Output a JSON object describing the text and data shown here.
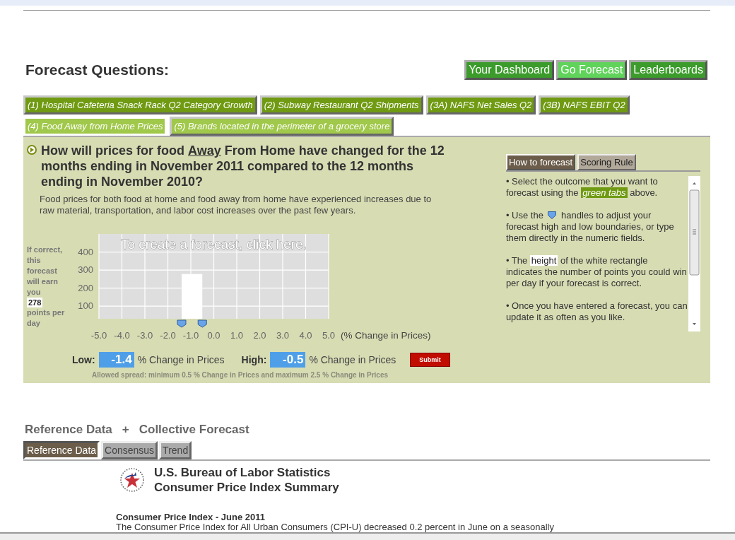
{
  "heading": "Forecast Questions:",
  "nav": [
    {
      "label": "Your Dashboard",
      "selected": false
    },
    {
      "label": "Go Forecast",
      "selected": true
    },
    {
      "label": "Leaderboards",
      "selected": false
    }
  ],
  "question_tabs": [
    {
      "label": "(1) Hospital Cafeteria Snack Rack Q2 Category Growth",
      "selected": false,
      "color": "#6f9a12"
    },
    {
      "label": "(2) Subway Restaurant Q2 Shipments",
      "selected": false,
      "color": "#6f9a12"
    },
    {
      "label": "(3A) NAFS Net Sales Q2",
      "selected": false,
      "color": "#6f9a12"
    },
    {
      "label": "(3B) NAFS EBIT Q2",
      "selected": false,
      "color": "#6f9a12"
    },
    {
      "label": "(4) Food Away from Home Prices",
      "selected": true,
      "color": "#a0c84a"
    },
    {
      "label": "(5) Brands located in the perimeter of a grocery store",
      "selected": false,
      "color": "#a0c84a"
    }
  ],
  "question": {
    "title": "How will prices for food **Away** From Home have changed for the 12 months ending in November 2011 compared to the 12 months ending in November 2010?",
    "description": "Food prices for both food at home and food away from home have experienced increases due to raw material, transportation, and labor cost increases over the past few years."
  },
  "earn": {
    "before": "If correct, this forecast will earn you",
    "points": "278",
    "after": "points per day"
  },
  "chart_data": {
    "type": "bar",
    "xlabel": "(% Change in Prices)",
    "xlim": [
      -5,
      5
    ],
    "ylim": [
      30,
      500
    ],
    "grid": true,
    "xticks": [
      {
        "value": -5,
        "label": "-5.0"
      },
      {
        "value": -4,
        "label": "-4.0"
      },
      {
        "value": -3,
        "label": "-3.0"
      },
      {
        "value": -2,
        "label": "-2.0"
      },
      {
        "value": -1,
        "label": "-1.0"
      },
      {
        "value": 0,
        "label": "0.0"
      },
      {
        "value": 1,
        "label": "1.0"
      },
      {
        "value": 2,
        "label": "2.0"
      },
      {
        "value": 3,
        "label": "3.0"
      },
      {
        "value": 4,
        "label": "4.0"
      },
      {
        "value": 5,
        "label": "5.0"
      }
    ],
    "yticks": [
      100,
      200,
      300,
      400
    ],
    "x": [
      -0.95
    ],
    "values": [
      278
    ],
    "annotations": [
      "To create a forecast, click here."
    ]
  },
  "range": {
    "low_label": "Low:",
    "low": "-1.4",
    "high_label": "High:",
    "high": "-0.5",
    "unit_low": "% Change in Prices",
    "unit_high": "% Change in Prices",
    "submit": "Submit",
    "note": "Allowed spread: minimum 0.5 % Change in Prices and maximum 2.5 % Change in Prices"
  },
  "help_tabs": [
    {
      "label": "How to forecast",
      "selected": true
    },
    {
      "label": "Scoring Rule",
      "selected": false
    }
  ],
  "help": [
    [
      {
        "kind": "line",
        "text": "• Select the outcome that you want to"
      },
      {
        "kind": "text",
        "text": "forecast using the"
      },
      {
        "kind": "green",
        "text": "green tabs"
      },
      {
        "kind": "text",
        "text": "above."
      }
    ],
    [
      {
        "kind": "text",
        "text": "• Use the"
      },
      {
        "kind": "icon"
      },
      {
        "kind": "text",
        "text": "handles to adjust your"
      },
      {
        "kind": "line",
        "text": "forecast high and low boundaries, or type them directly in the numeric fields."
      }
    ],
    [
      {
        "kind": "text",
        "text": "• The"
      },
      {
        "kind": "white",
        "text": "height"
      },
      {
        "kind": "text",
        "text": "of the white rectangle"
      },
      {
        "kind": "line",
        "text": "indicates the number of points you could win per day if your forecast is correct."
      }
    ],
    [
      {
        "kind": "line",
        "text": "• Once you have entered a forecast, you can update it as often as you like."
      }
    ]
  ],
  "reference": {
    "title": "Reference Data",
    "plus": "+",
    "title2": "Collective Forecast"
  },
  "reference_tabs": [
    {
      "label": "Reference Data",
      "selected": true
    },
    {
      "label": "Consensus",
      "selected": false
    },
    {
      "label": "Trend",
      "selected": false
    }
  ],
  "bls": {
    "line1": "U.S. Bureau of Labor Statistics",
    "line2": "Consumer Price Index Summary",
    "subtitle": "Consumer Price Index - June 2011",
    "text": "The Consumer Price Index for All Urban Consumers (CPI-U) decreased 0.2 percent in June on a seasonally"
  }
}
